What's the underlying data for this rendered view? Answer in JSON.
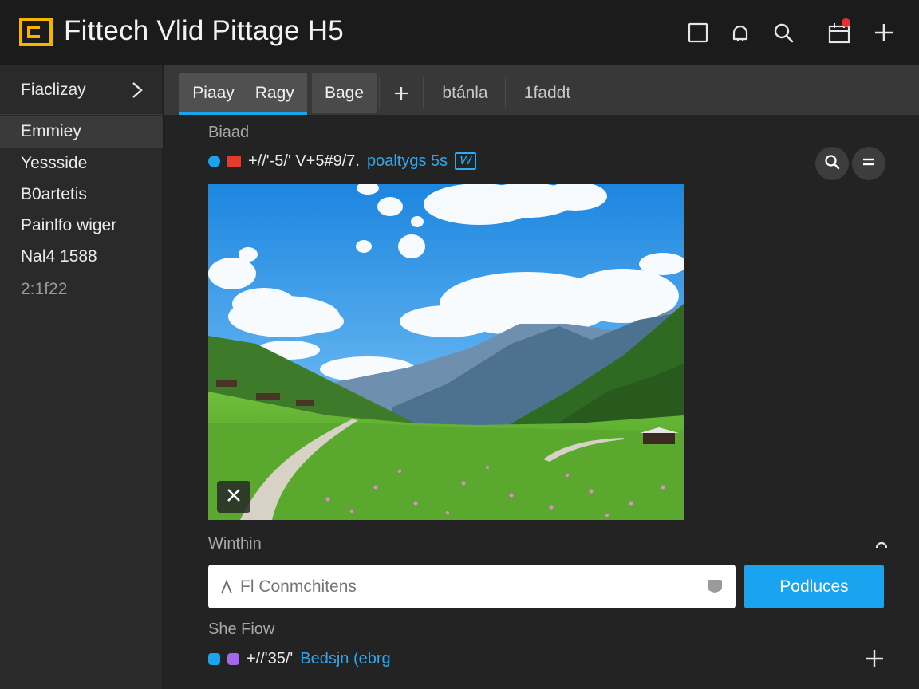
{
  "colors": {
    "accent": "#1aa3ef",
    "link": "#2fa8ee",
    "logo_yellow": "#f5b400",
    "notification": "#e53030",
    "dot_cyan": "#1aa3ef",
    "dot_red": "#e33b2e",
    "dot_purple": "#a568e8"
  },
  "header": {
    "title": "Fittech Vlid Pittage H5",
    "icons": [
      "square-icon",
      "bell-icon",
      "search-icon",
      "calendar-icon",
      "plus-icon"
    ]
  },
  "sidebar": {
    "heading": "Fiaclizay",
    "items": [
      {
        "label": "Emmiey",
        "active": true
      },
      {
        "label": "Yessside",
        "active": false
      },
      {
        "label": "B0artetis",
        "active": false
      },
      {
        "label": "Painlfo wiger",
        "active": false
      },
      {
        "label": "Nal4 1588",
        "active": false
      },
      {
        "label": "2:1f22",
        "active": false,
        "muted": true
      }
    ]
  },
  "tabs": {
    "items": [
      {
        "label": "Piaay",
        "active": true
      },
      {
        "label": "Ragy",
        "active": true
      },
      {
        "label": "Bage",
        "active": false
      },
      {
        "label": "+",
        "active": false
      },
      {
        "label": "btánla",
        "active": false
      },
      {
        "label": "1faddt",
        "active": false
      }
    ]
  },
  "main": {
    "section1_label": "Biaad",
    "meta1": {
      "text": "+//'-5/' V+5#9/7.",
      "link": "poaltygs 5s",
      "badge": "W"
    },
    "section2_label": "Winthin",
    "input": {
      "value": "",
      "placeholder": "Fl Conmchitens"
    },
    "primary_button": "Podluces",
    "section3_label": "She Fiow",
    "meta2": {
      "text": "+//'35/'",
      "link": "Bedsjn (ebrg"
    }
  }
}
